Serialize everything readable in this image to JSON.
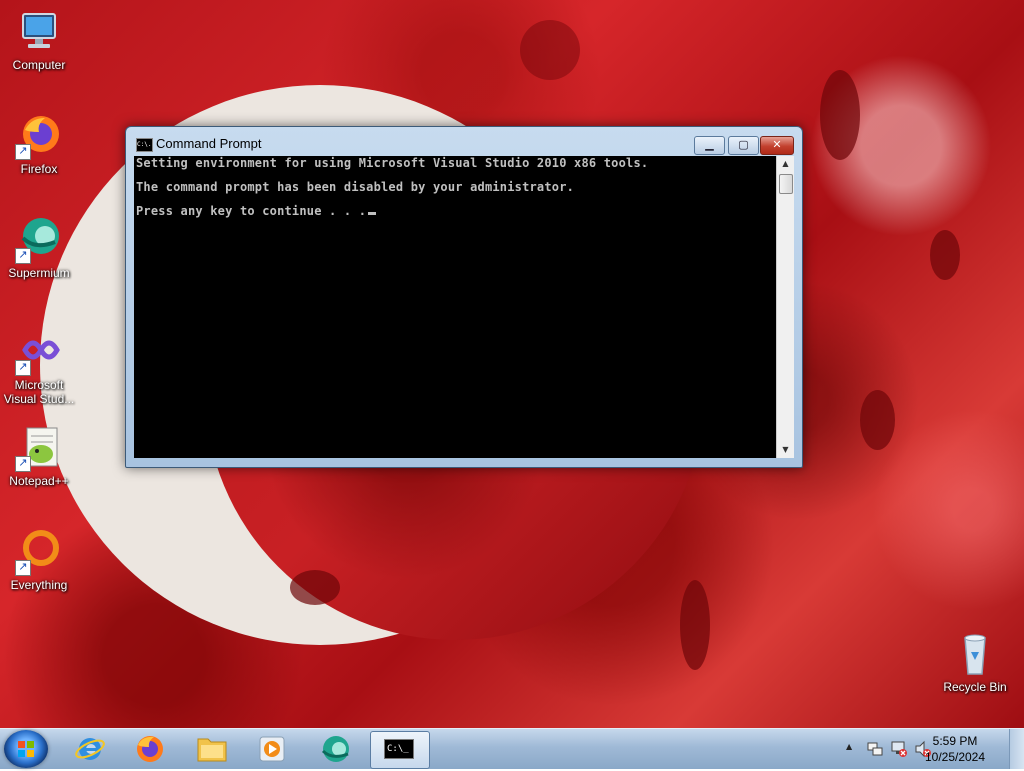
{
  "desktop": {
    "icons": [
      {
        "label": "Computer",
        "icon": "computer-icon"
      },
      {
        "label": "Firefox",
        "icon": "firefox-icon"
      },
      {
        "label": "Supermium",
        "icon": "supermium-icon"
      },
      {
        "label_line1": "Microsoft",
        "label_line2": "Visual Stud...",
        "icon": "visual-studio-icon"
      },
      {
        "label": "Notepad++",
        "icon": "notepadpp-icon"
      },
      {
        "label": "Everything",
        "icon": "everything-icon"
      },
      {
        "label": "Recycle Bin",
        "icon": "recycle-bin-icon"
      }
    ]
  },
  "cmd_window": {
    "title": "Command Prompt",
    "title_icon_text": "C:\\.",
    "buttons": {
      "minimize": "▁",
      "maximize": "▢",
      "close": "✕"
    },
    "lines": [
      "Setting environment for using Microsoft Visual Studio 2010 x86 tools.",
      "The command prompt has been disabled by your administrator.",
      "Press any key to continue . . ."
    ],
    "scroll_up": "▲",
    "scroll_down": "▼"
  },
  "taskbar": {
    "pinned": [
      "start-button",
      "internet-explorer",
      "firefox",
      "file-explorer",
      "media-player",
      "supermium",
      "command-prompt"
    ],
    "cmd_button_text": "C:\\_",
    "tray": {
      "overflow": "▲",
      "time": "5:59 PM",
      "date": "10/25/2024"
    }
  },
  "colors": {
    "desktop_red": "#c8201f",
    "console_bg": "#000000",
    "console_text": "#c0c0c0",
    "close_red": "#c2402e",
    "taskbar_blue": "#9fb9d6"
  }
}
